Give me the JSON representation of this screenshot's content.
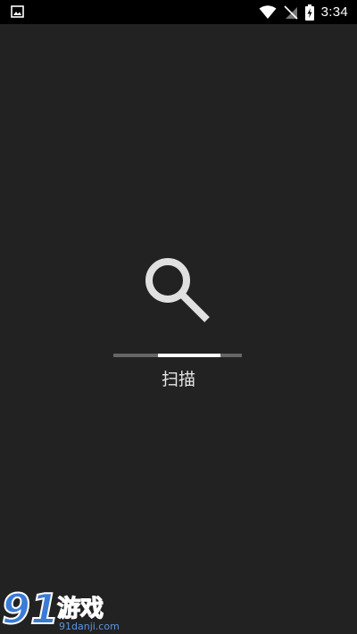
{
  "status_bar": {
    "time": "3:34",
    "icons": [
      "image-notification-icon",
      "wifi-icon",
      "no-sim-icon",
      "battery-charging-icon"
    ]
  },
  "scan": {
    "label": "扫描",
    "progress_start": 0.35,
    "progress_end": 0.83
  },
  "watermark": {
    "logo_number": "91",
    "brand": "游戏",
    "site": "91danji.com"
  },
  "colors": {
    "background": "#222222",
    "status_bar": "#000000",
    "icon": "#e0e0e0",
    "progress_track": "#666666",
    "progress_fill": "#ffffff",
    "watermark_blue": "#3a7bd5"
  }
}
